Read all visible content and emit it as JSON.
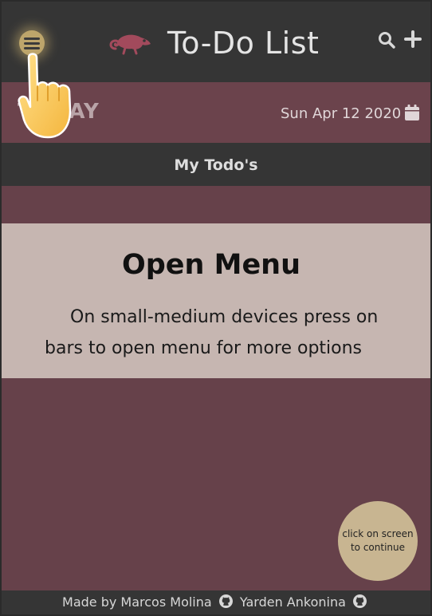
{
  "header": {
    "title": "To-Do List",
    "menu_icon": "menu-bars-icon",
    "logo_icon": "chameleon-logo-icon",
    "search_icon": "search-icon",
    "add_icon": "plus-icon"
  },
  "today": {
    "label": "TODAY",
    "date": "Sun Apr 12 2020",
    "calendar_icon": "calendar-icon"
  },
  "todos": {
    "label": "My Todo's"
  },
  "tour": {
    "title": "Open Menu",
    "text": "On small-medium devices press on bars to open menu for more options",
    "continue": "click on screen to continue",
    "pointer_icon": "pointing-hand-icon"
  },
  "footer": {
    "made_by": "Made by Marcos Molina",
    "second_author": "Yarden Ankonina",
    "github_icon": "github-icon"
  },
  "colors": {
    "header_bg": "#353535",
    "accent": "#66414a",
    "panel": "#c6b6b1",
    "bubble": "#c8b591",
    "logo": "#a24a5c"
  }
}
